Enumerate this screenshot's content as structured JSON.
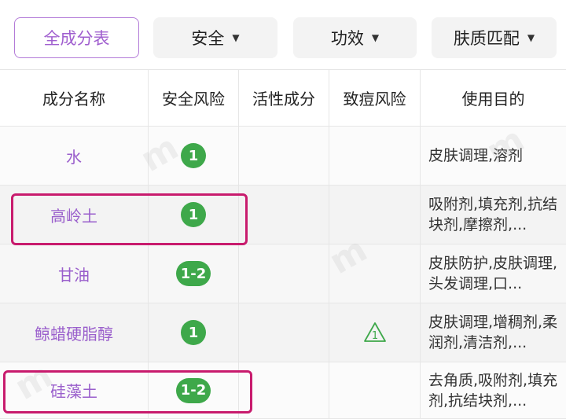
{
  "filters": {
    "all_label": "全成分表",
    "safety_label": "安全",
    "efficacy_label": "功效",
    "skin_label": "肤质匹配"
  },
  "table": {
    "headers": [
      "成分名称",
      "安全风险",
      "活性成分",
      "致痘风险",
      "使用目的"
    ],
    "rows": [
      {
        "name": "水",
        "safety": "1",
        "active": "",
        "acne": false,
        "purpose": "皮肤调理,溶剂"
      },
      {
        "name": "高岭土",
        "safety": "1",
        "active": "",
        "acne": false,
        "purpose": "吸附剂,填充剂,抗结块剂,摩擦剂,..."
      },
      {
        "name": "甘油",
        "safety": "1-2",
        "active": "",
        "acne": false,
        "purpose": "皮肤防护,皮肤调理,头发调理,口..."
      },
      {
        "name": "鲸蜡硬脂醇",
        "safety": "1",
        "active": "",
        "acne": true,
        "purpose": "皮肤调理,增稠剂,柔润剂,清洁剂,..."
      },
      {
        "name": "硅藻土",
        "safety": "1-2",
        "active": "",
        "acne": false,
        "purpose": "去角质,吸附剂,填充剂,抗结块剂,..."
      }
    ]
  },
  "acne_icon_label": "1",
  "colors": {
    "accent_purple": "#9a5fcc",
    "badge_green": "#3ea84a",
    "highlight": "#c81b6d"
  }
}
